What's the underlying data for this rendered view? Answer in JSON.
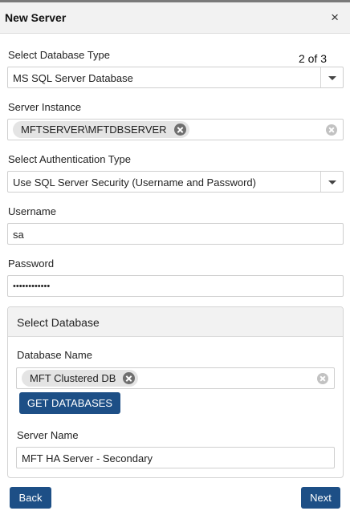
{
  "dialog": {
    "title": "New Server",
    "close_glyph": "×",
    "step": "2 of 3"
  },
  "db_type": {
    "label": "Select Database Type",
    "value": "MS SQL Server Database"
  },
  "server_instance": {
    "label": "Server Instance",
    "chip": "MFTSERVER\\MFTDBSERVER"
  },
  "auth_type": {
    "label": "Select Authentication Type",
    "value": "Use SQL Server Security (Username and Password)"
  },
  "username": {
    "label": "Username",
    "value": "sa"
  },
  "password": {
    "label": "Password",
    "value": "••••••••••••"
  },
  "select_database": {
    "title": "Select Database",
    "db_name_label": "Database Name",
    "db_chip": "MFT Clustered DB",
    "get_button": "GET DATABASES",
    "server_name_label": "Server Name",
    "server_name_value": "MFT HA Server - Secondary"
  },
  "footer": {
    "back": "Back",
    "next": "Next"
  },
  "colors": {
    "primary_button": "#1d4f86",
    "header_bg": "#f2f2f2",
    "chip_bg": "#e4e4e4"
  },
  "icons": {
    "close": "close-icon",
    "dropdown": "chevron-down-icon",
    "chip_remove": "remove-circle-icon",
    "clear": "clear-circle-icon"
  }
}
